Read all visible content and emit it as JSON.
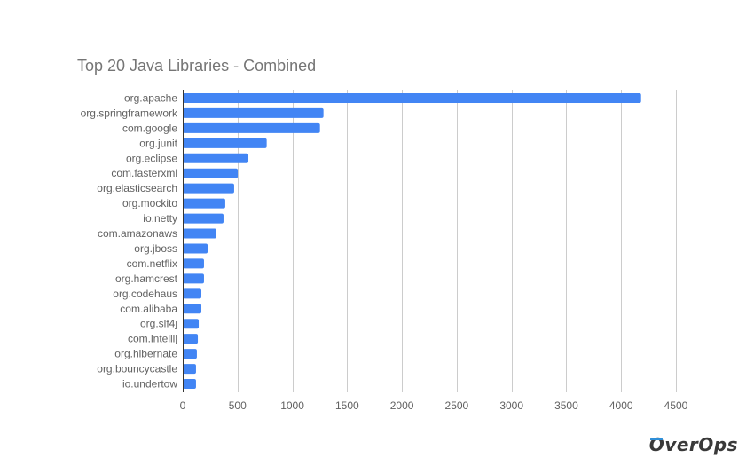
{
  "chart_data": {
    "type": "bar",
    "orientation": "horizontal",
    "title": "Top 20 Java Libraries - Combined",
    "xlabel": "",
    "ylabel": "",
    "xlim": [
      0,
      4500
    ],
    "xticks": [
      0,
      500,
      1000,
      1500,
      2000,
      2500,
      3000,
      3500,
      4000,
      4500
    ],
    "grid": true,
    "legend": "none",
    "bar_color": "#4285f4",
    "categories": [
      "org.apache",
      "org.springframework",
      "com.google",
      "org.junit",
      "org.eclipse",
      "com.fasterxml",
      "org.elasticsearch",
      "org.mockito",
      "io.netty",
      "com.amazonaws",
      "org.jboss",
      "com.netflix",
      "org.hamcrest",
      "org.codehaus",
      "com.alibaba",
      "org.slf4j",
      "com.intellij",
      "org.hibernate",
      "org.bouncycastle",
      "io.undertow"
    ],
    "values": [
      4182,
      1284,
      1252,
      766,
      599,
      502,
      469,
      388,
      372,
      306,
      227,
      194,
      194,
      170,
      170,
      146,
      138,
      129,
      121,
      121
    ]
  },
  "branding": {
    "logo_text_first": "O",
    "logo_text_rest": "verOps",
    "logo_accent": "#2f8fd8"
  }
}
